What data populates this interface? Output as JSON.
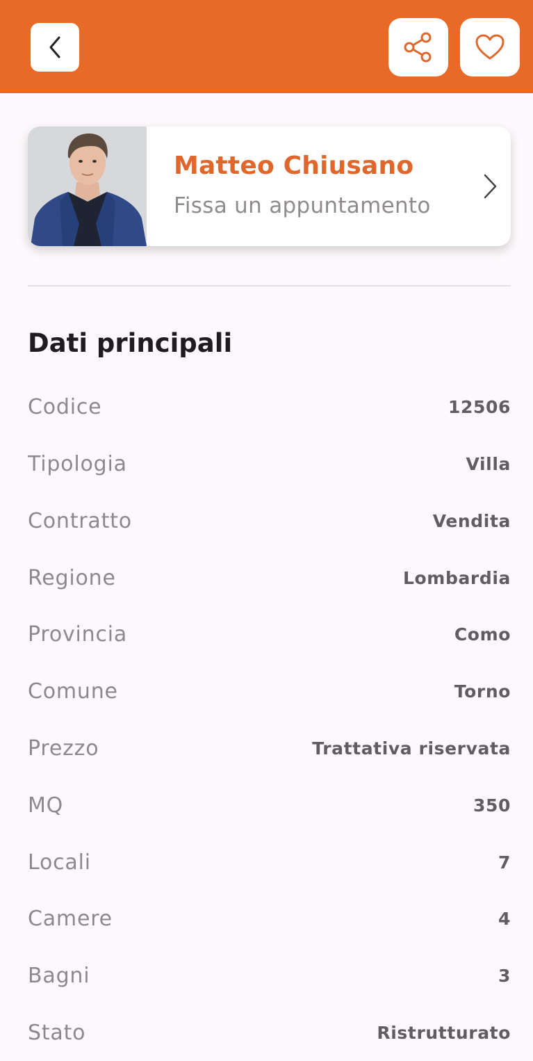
{
  "header": {
    "back_icon": "chevron-left-icon",
    "share_icon": "share-icon",
    "favorite_icon": "heart-icon"
  },
  "agent": {
    "name": "Matteo Chiusano",
    "subtitle": "Fissa un appuntamento",
    "chevron_icon": "chevron-right-icon"
  },
  "details": {
    "title": "Dati principali",
    "rows": [
      {
        "label": "Codice",
        "value": "12506"
      },
      {
        "label": "Tipologia",
        "value": "Villa"
      },
      {
        "label": "Contratto",
        "value": "Vendita"
      },
      {
        "label": "Regione",
        "value": "Lombardia"
      },
      {
        "label": "Provincia",
        "value": "Como"
      },
      {
        "label": "Comune",
        "value": "Torno"
      },
      {
        "label": "Prezzo",
        "value": "Trattativa riservata"
      },
      {
        "label": "MQ",
        "value": "350"
      },
      {
        "label": "Locali",
        "value": "7"
      },
      {
        "label": "Camere",
        "value": "4"
      },
      {
        "label": "Bagni",
        "value": "3"
      },
      {
        "label": "Stato",
        "value": "Ristrutturato"
      }
    ]
  },
  "colors": {
    "accent": "#e96a26",
    "background": "#fcf8fb"
  }
}
